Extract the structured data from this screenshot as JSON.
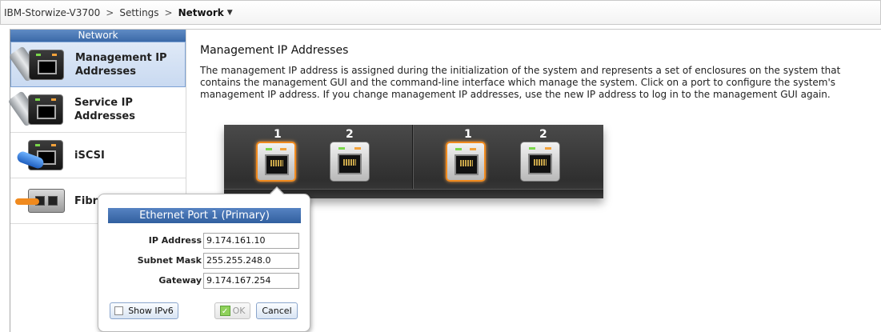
{
  "breadcrumb": {
    "system": "IBM-Storwize-V3700",
    "separator": ">",
    "section": "Settings",
    "current": "Network",
    "dropdown_icon": "triangle-down-icon"
  },
  "nav": {
    "title": "Network",
    "items": [
      {
        "label_line1": "Management IP",
        "label_line2": "Addresses",
        "icon": "management-ip-icon",
        "active": true
      },
      {
        "label": "Service IP Addresses",
        "icon": "service-ip-icon",
        "active": false
      },
      {
        "label": "iSCSI",
        "icon": "iscsi-icon",
        "active": false
      },
      {
        "label": "Fibre",
        "icon": "fibre-channel-icon",
        "active": false
      }
    ]
  },
  "main": {
    "title": "Management IP Addresses",
    "description": "The management IP address is assigned during the initialization of the system and represents a set of enclosures on the system that contains the management GUI and the command-line interface which manage the system. Click on a port to configure the system's management IP address. If you change management IP addresses, use the new IP address to log in to the management GUI again."
  },
  "ports": {
    "left_group": [
      {
        "number": "1",
        "selected": true
      },
      {
        "number": "2",
        "selected": false
      }
    ],
    "right_group": [
      {
        "number": "1",
        "selected": true
      },
      {
        "number": "2",
        "selected": false
      }
    ]
  },
  "popup": {
    "title": "Ethernet Port 1 (Primary)",
    "fields": {
      "ip_label": "IP Address",
      "ip_value": "9.174.161.10",
      "subnet_label": "Subnet Mask",
      "subnet_value": "255.255.248.0",
      "gateway_label": "Gateway",
      "gateway_value": "9.174.167.254"
    },
    "show_ipv6_label": "Show IPv6",
    "ok_label": "OK",
    "cancel_label": "Cancel"
  },
  "colors": {
    "accent_blue": "#3b69a8",
    "selected_orange": "#f08a1e",
    "led_green": "#7ad64a",
    "led_amber": "#f3a23b"
  }
}
